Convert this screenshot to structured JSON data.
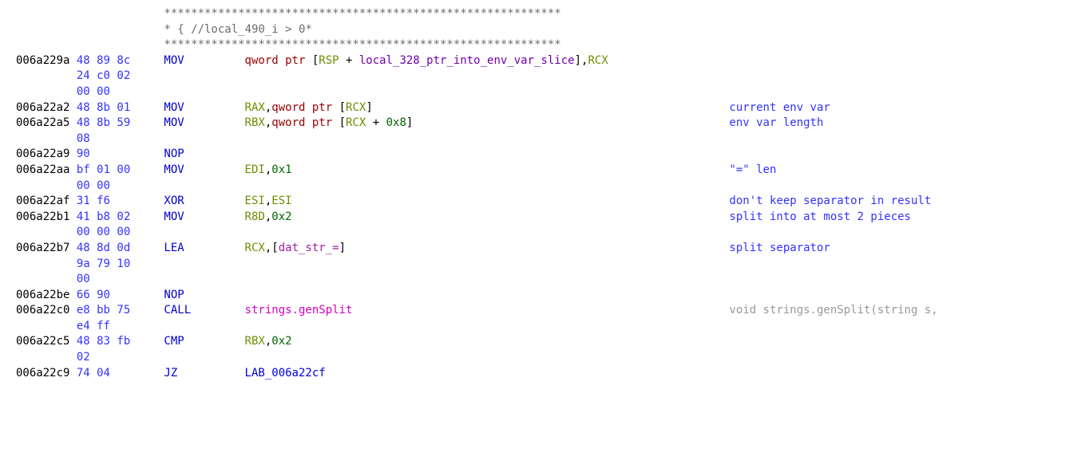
{
  "banner": {
    "stars_top": "***********************************************************",
    "comment_line_pre": "* { // ",
    "comment_text": "local_490_i > 0",
    "comment_line_post": "                                          *",
    "stars_bot": "***********************************************************"
  },
  "rows": [
    {
      "addr": "006a229a",
      "bytes": [
        "48 89 8c",
        "24 c0 02",
        "00 00"
      ],
      "mn": "MOV",
      "operand_parts": [
        {
          "text": "qword ptr ",
          "cls": "darkred"
        },
        {
          "text": "[",
          "cls": "txt"
        },
        {
          "text": "RSP",
          "cls": "reg"
        },
        {
          "text": " + ",
          "cls": "txt"
        },
        {
          "text": "local_328_ptr_into_env_var_slice",
          "cls": "var"
        },
        {
          "text": "]",
          "cls": "txt"
        },
        {
          "text": ",",
          "cls": "txt"
        },
        {
          "text": "RCX",
          "cls": "reg"
        }
      ],
      "comment": ""
    },
    {
      "addr": "006a22a2",
      "bytes": [
        "48 8b 01"
      ],
      "mn": "MOV",
      "operand_parts": [
        {
          "text": "RAX",
          "cls": "reg"
        },
        {
          "text": ",",
          "cls": "txt"
        },
        {
          "text": "qword ptr ",
          "cls": "darkred"
        },
        {
          "text": "[",
          "cls": "txt"
        },
        {
          "text": "RCX",
          "cls": "reg"
        },
        {
          "text": "]",
          "cls": "txt"
        }
      ],
      "comment": "current env var"
    },
    {
      "addr": "006a22a5",
      "bytes": [
        "48 8b 59",
        "08"
      ],
      "mn": "MOV",
      "operand_parts": [
        {
          "text": "RBX",
          "cls": "reg"
        },
        {
          "text": ",",
          "cls": "txt"
        },
        {
          "text": "qword ptr ",
          "cls": "darkred"
        },
        {
          "text": "[",
          "cls": "txt"
        },
        {
          "text": "RCX",
          "cls": "reg"
        },
        {
          "text": " + ",
          "cls": "txt"
        },
        {
          "text": "0x8",
          "cls": "num"
        },
        {
          "text": "]",
          "cls": "txt"
        }
      ],
      "comment": "env var length"
    },
    {
      "addr": "006a22a9",
      "bytes": [
        "90"
      ],
      "mn": "NOP",
      "operand_parts": [],
      "comment": ""
    },
    {
      "addr": "006a22aa",
      "bytes": [
        "bf 01 00",
        "00 00"
      ],
      "mn": "MOV",
      "operand_parts": [
        {
          "text": "EDI",
          "cls": "reg"
        },
        {
          "text": ",",
          "cls": "txt"
        },
        {
          "text": "0x1",
          "cls": "num"
        }
      ],
      "comment": "\"=\" len"
    },
    {
      "addr": "006a22af",
      "bytes": [
        "31 f6"
      ],
      "mn": "XOR",
      "operand_parts": [
        {
          "text": "ESI",
          "cls": "reg"
        },
        {
          "text": ",",
          "cls": "txt"
        },
        {
          "text": "ESI",
          "cls": "reg"
        }
      ],
      "comment": "don't keep separator in result"
    },
    {
      "addr": "006a22b1",
      "bytes": [
        "41 b8 02",
        "00 00 00"
      ],
      "mn": "MOV",
      "operand_parts": [
        {
          "text": "R8D",
          "cls": "reg"
        },
        {
          "text": ",",
          "cls": "txt"
        },
        {
          "text": "0x2",
          "cls": "num"
        }
      ],
      "comment": "split into at most 2 pieces"
    },
    {
      "addr": "006a22b7",
      "bytes": [
        "48 8d 0d",
        "9a 79 10",
        "00"
      ],
      "mn": "LEA",
      "operand_parts": [
        {
          "text": "RCX",
          "cls": "reg"
        },
        {
          "text": ",",
          "cls": "txt"
        },
        {
          "text": "[",
          "cls": "txt"
        },
        {
          "text": "dat_str_=",
          "cls": "sym"
        },
        {
          "text": "]",
          "cls": "txt"
        }
      ],
      "comment": "split separator"
    },
    {
      "addr": "006a22be",
      "bytes": [
        "66 90"
      ],
      "mn": "NOP",
      "operand_parts": [],
      "comment": ""
    },
    {
      "addr": "006a22c0",
      "bytes": [
        "e8 bb 75",
        "e4 ff"
      ],
      "mn": "CALL",
      "operand_parts": [
        {
          "text": "strings.genSplit",
          "cls": "call"
        }
      ],
      "comment": "void strings.genSplit(string s,",
      "comment_gray": true
    },
    {
      "addr": "006a22c5",
      "bytes": [
        "48 83 fb",
        "02"
      ],
      "mn": "CMP",
      "operand_parts": [
        {
          "text": "RBX",
          "cls": "reg"
        },
        {
          "text": ",",
          "cls": "txt"
        },
        {
          "text": "0x2",
          "cls": "num"
        }
      ],
      "comment": ""
    },
    {
      "addr": "006a22c9",
      "bytes": [
        "74 04"
      ],
      "mn": "JZ",
      "operand_parts": [
        {
          "text": "LAB_006a22cf",
          "cls": "lbl"
        }
      ],
      "comment": ""
    }
  ]
}
